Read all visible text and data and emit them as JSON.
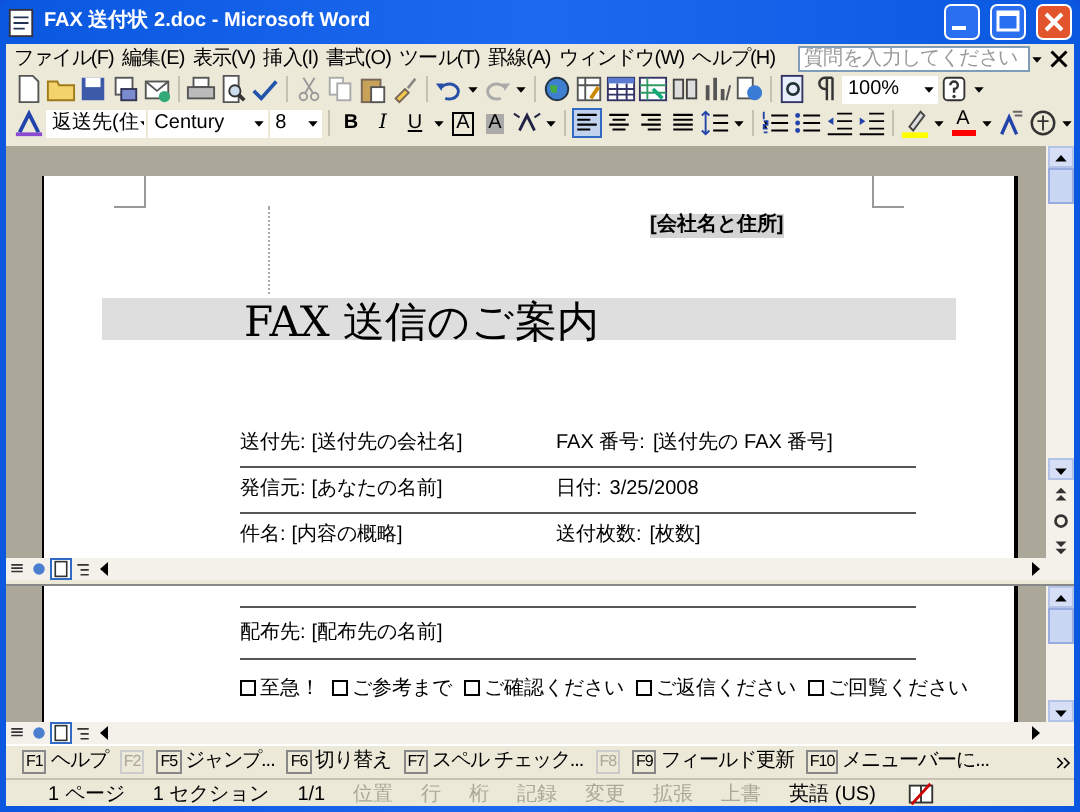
{
  "window": {
    "title": "FAX 送付状 2.doc - Microsoft Word"
  },
  "menu": [
    {
      "label": "ファイル(F)"
    },
    {
      "label": "編集(E)"
    },
    {
      "label": "表示(V)"
    },
    {
      "label": "挿入(I)"
    },
    {
      "label": "書式(O)"
    },
    {
      "label": "ツール(T)"
    },
    {
      "label": "罫線(A)"
    },
    {
      "label": "ウィンドウ(W)"
    },
    {
      "label": "ヘルプ(H)"
    }
  ],
  "help_box": {
    "placeholder": "質問を入力してください"
  },
  "standard_toolbar": {
    "zoom": "100%"
  },
  "formatting_toolbar": {
    "style": "返送先(住",
    "font": "Century",
    "size": "8",
    "text_buttons": [
      {
        "label": "B",
        "kind": "bold"
      },
      {
        "label": "I",
        "kind": "italic"
      },
      {
        "label": "U",
        "kind": "underline"
      },
      {
        "label": "A",
        "kind": "border"
      },
      {
        "label": "A",
        "kind": "shading"
      }
    ],
    "alignment": [
      {
        "selected": true
      },
      {
        "selected": false
      },
      {
        "selected": false
      },
      {
        "selected": false
      }
    ],
    "font_color": {
      "label": "A",
      "color": "#ff0000"
    }
  },
  "document": {
    "header": "[会社名と住所]",
    "title": "FAX 送信のご案内",
    "fields": [
      {
        "label": "送付先:",
        "value": "[送付先の会社名]",
        "label_2": "FAX 番号:",
        "value_2": "[送付先の FAX 番号]"
      },
      {
        "label": "発信元:",
        "value": "[あなたの名前]",
        "label_2": "日付:",
        "value_2": "3/25/2008"
      },
      {
        "label": "件名:",
        "value": "[内容の概略]",
        "label_2": "送付枚数:",
        "value_2": "[枚数]"
      }
    ],
    "bottom_fields": [
      {
        "label": "配布先:",
        "value": "[配布先の名前]"
      }
    ],
    "options": [
      {
        "label": "至急！",
        "checked": false
      },
      {
        "label": "ご参考まで",
        "checked": false
      },
      {
        "label": "ご確認ください",
        "checked": false
      },
      {
        "label": "ご返信ください",
        "checked": false
      },
      {
        "label": "ご回覧ください",
        "checked": false
      }
    ]
  },
  "top_pane": {
    "view_buttons": [
      {
        "selected": false
      },
      {
        "selected": false
      },
      {
        "selected": true
      },
      {
        "selected": false
      }
    ]
  },
  "bottom_pane": {
    "view_buttons": [
      {
        "selected": false
      },
      {
        "selected": false
      },
      {
        "selected": true
      },
      {
        "selected": false
      }
    ]
  },
  "function_keys": [
    {
      "key": "F1",
      "label": "ヘルプ",
      "disabled": false
    },
    {
      "key": "F2",
      "disabled": true
    },
    {
      "key": "F5",
      "label": "ジャンプ...",
      "disabled": false
    },
    {
      "key": "F6",
      "label": "切り替え",
      "disabled": false
    },
    {
      "key": "F7",
      "label": "スペル チェック...",
      "disabled": false
    },
    {
      "key": "F8",
      "disabled": true
    },
    {
      "key": "F9",
      "label": "フィールド更新",
      "disabled": false
    },
    {
      "key": "F10",
      "label": "メニューバーに...",
      "disabled": false
    }
  ],
  "status_bar": [
    {
      "text": "1 ページ",
      "disabled": false
    },
    {
      "text": "1 セクション",
      "disabled": false
    },
    {
      "text": "1/1",
      "disabled": false
    },
    {
      "text": "位置",
      "disabled": true
    },
    {
      "text": "行",
      "disabled": true
    },
    {
      "text": "桁",
      "disabled": true
    },
    {
      "text": "記録",
      "disabled": true
    },
    {
      "text": "変更",
      "disabled": true
    },
    {
      "text": "拡張",
      "disabled": true
    },
    {
      "text": "上書",
      "disabled": true
    },
    {
      "text": "英語 (US)",
      "disabled": false
    }
  ]
}
